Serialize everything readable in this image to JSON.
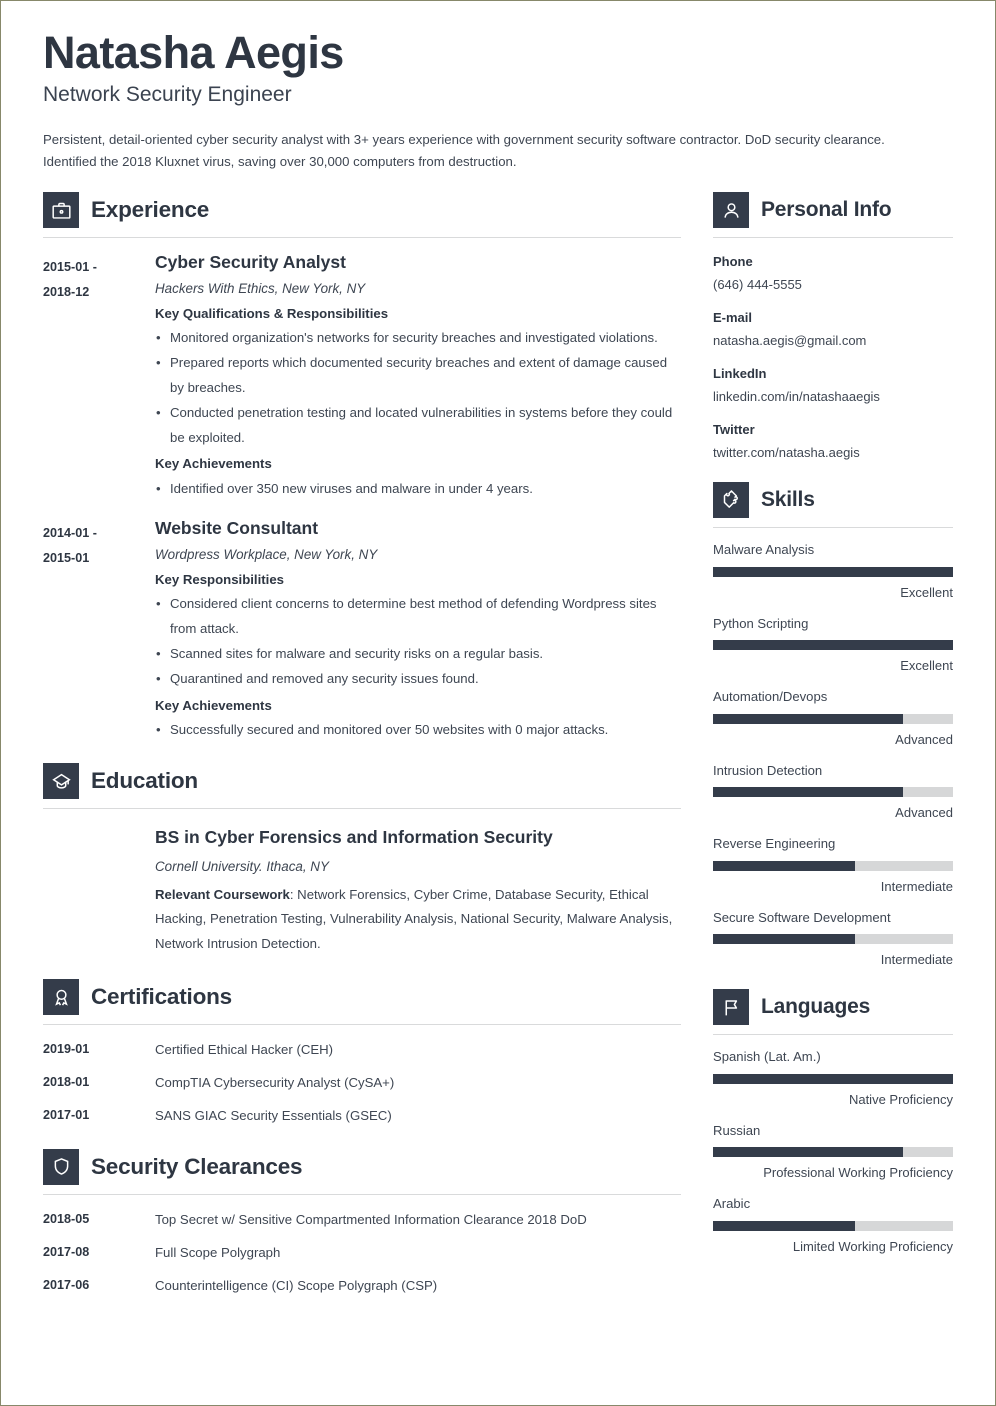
{
  "theme": {
    "dark": "#343c4a",
    "text": "#2e3642",
    "body_text": "#3e4652",
    "track": "#d6d7d8",
    "rule": "#d9dadb",
    "page_border": "#87886a"
  },
  "header": {
    "name": "Natasha Aegis",
    "job_title": "Network Security Engineer",
    "summary": "Persistent, detail-oriented cyber security analyst with 3+ years experience with government security software contractor. DoD security clearance. Identified the 2018 Kluxnet virus, saving over 30,000 computers from destruction."
  },
  "experience": {
    "title": "Experience",
    "icon": "briefcase-icon",
    "entries": [
      {
        "date_start": "2015-01 -",
        "date_end": "2018-12",
        "role": "Cyber Security Analyst",
        "org": "Hackers With Ethics, New York, NY",
        "groups": [
          {
            "heading": "Key Qualifications & Responsibilities",
            "bullets": [
              "Monitored organization's networks for security breaches and investigated violations.",
              "Prepared reports which documented security breaches and extent of damage caused by breaches.",
              "Conducted penetration testing and located vulnerabilities in systems before they could be exploited."
            ]
          },
          {
            "heading": "Key Achievements",
            "bullets": [
              "Identified over 350 new viruses and malware in under 4 years."
            ]
          }
        ]
      },
      {
        "date_start": "2014-01 -",
        "date_end": "2015-01",
        "role": "Website Consultant",
        "org": "Wordpress Workplace, New York, NY",
        "groups": [
          {
            "heading": "Key Responsibilities",
            "bullets": [
              "Considered client concerns to determine best method of defending Wordpress sites from attack.",
              "Scanned sites for malware and security risks on a regular basis.",
              "Quarantined and removed any security issues found."
            ]
          },
          {
            "heading": "Key Achievements",
            "bullets": [
              "Successfully secured and monitored over 50 websites with 0 major attacks."
            ]
          }
        ]
      }
    ]
  },
  "education": {
    "title": "Education",
    "icon": "graduation-cap-icon",
    "degree": "BS in Cyber Forensics and Information Security",
    "school": "Cornell University. Ithaca, NY",
    "coursework_label": "Relevant Coursework",
    "coursework_text": ": Network Forensics, Cyber Crime, Database Security, Ethical Hacking, Penetration Testing, Vulnerability Analysis, National Security, Malware Analysis, Network Intrusion Detection."
  },
  "certifications": {
    "title": "Certifications",
    "icon": "award-ribbon-icon",
    "rows": [
      {
        "date": "2019-01",
        "text": "Certified Ethical Hacker (CEH)"
      },
      {
        "date": "2018-01",
        "text": "CompTIA Cybersecurity Analyst (CySA+)"
      },
      {
        "date": "2017-01",
        "text": "SANS GIAC Security Essentials (GSEC)"
      }
    ]
  },
  "clearances": {
    "title": "Security Clearances",
    "icon": "shield-icon",
    "rows": [
      {
        "date": "2018-05",
        "text": "Top Secret w/ Sensitive Compartmented Information Clearance 2018 DoD"
      },
      {
        "date": "2017-08",
        "text": "Full Scope Polygraph"
      },
      {
        "date": "2017-06",
        "text": "Counterintelligence (CI) Scope Polygraph (CSP)"
      }
    ]
  },
  "personal_info": {
    "title": "Personal Info",
    "icon": "person-icon",
    "fields": [
      {
        "label": "Phone",
        "value": "(646) 444-5555"
      },
      {
        "label": "E-mail",
        "value": "natasha.aegis@gmail.com"
      },
      {
        "label": "LinkedIn",
        "value": "linkedin.com/in/natashaaegis"
      },
      {
        "label": "Twitter",
        "value": "twitter.com/natasha.aegis"
      }
    ]
  },
  "skills": {
    "title": "Skills",
    "icon": "puzzle-piece-icon",
    "items": [
      {
        "name": "Malware Analysis",
        "level": "Excellent",
        "percent": 100
      },
      {
        "name": "Python Scripting",
        "level": "Excellent",
        "percent": 100
      },
      {
        "name": "Automation/Devops",
        "level": "Advanced",
        "percent": 79
      },
      {
        "name": "Intrusion Detection",
        "level": "Advanced",
        "percent": 79
      },
      {
        "name": "Reverse Engineering",
        "level": "Intermediate",
        "percent": 59
      },
      {
        "name": "Secure Software Development",
        "level": "Intermediate",
        "percent": 59
      }
    ]
  },
  "languages": {
    "title": "Languages",
    "icon": "flag-icon",
    "items": [
      {
        "name": "Spanish (Lat. Am.)",
        "level": "Native Proficiency",
        "percent": 100
      },
      {
        "name": "Russian",
        "level": "Professional Working Proficiency",
        "percent": 79
      },
      {
        "name": "Arabic",
        "level": "Limited Working Proficiency",
        "percent": 59
      }
    ]
  }
}
